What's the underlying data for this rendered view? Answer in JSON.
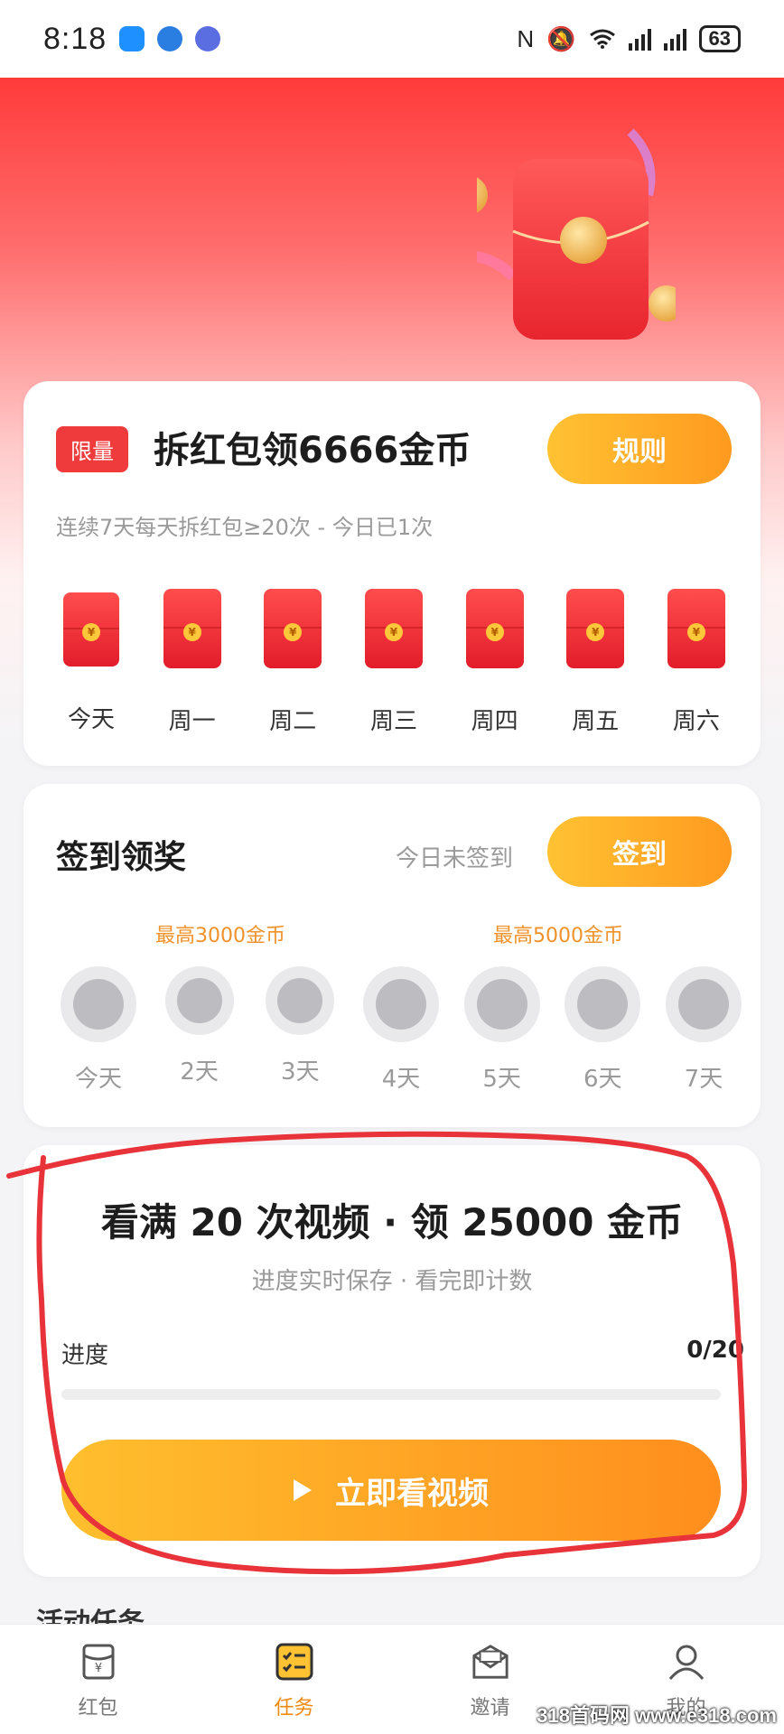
{
  "status_bar": {
    "time": "8:18",
    "battery": "63"
  },
  "hero": {
    "badge": "限量",
    "title": "拆红包领6666金币",
    "rules_button": "规则",
    "subtitle": "连续7天每天拆红包≥20次 - 今日已1次",
    "days": [
      "今天",
      "周一",
      "周二",
      "周三",
      "周四",
      "周五",
      "周六"
    ],
    "coin_symbol": "¥"
  },
  "sign_in": {
    "title": "签到领奖",
    "status": "今日未签到",
    "button": "签到",
    "max_reward_1": "最高3000金币",
    "max_reward_2": "最高5000金币",
    "days": [
      "今天",
      "2天",
      "3天",
      "4天",
      "5天",
      "6天",
      "7天"
    ]
  },
  "video_task": {
    "title": "看满 20 次视频 · 领 25000 金币",
    "subtitle": "进度实时保存 · 看完即计数",
    "progress_label": "进度",
    "progress_value": "0/20",
    "progress_fraction": 0,
    "button": "立即看视频"
  },
  "section_peek": "活动任务",
  "bottom_nav": {
    "items": [
      {
        "label": "红包",
        "icon": "red-envelope-icon",
        "active": false
      },
      {
        "label": "任务",
        "icon": "task-list-icon",
        "active": true
      },
      {
        "label": "邀请",
        "icon": "invite-mail-icon",
        "active": false
      },
      {
        "label": "我的",
        "icon": "profile-icon",
        "active": false
      }
    ]
  },
  "watermark": "318首码网 www.e318.com",
  "colors": {
    "accent_red": "#ef3b3b",
    "accent_orange": "#ff9a1f",
    "active_nav": "#f08a12"
  }
}
